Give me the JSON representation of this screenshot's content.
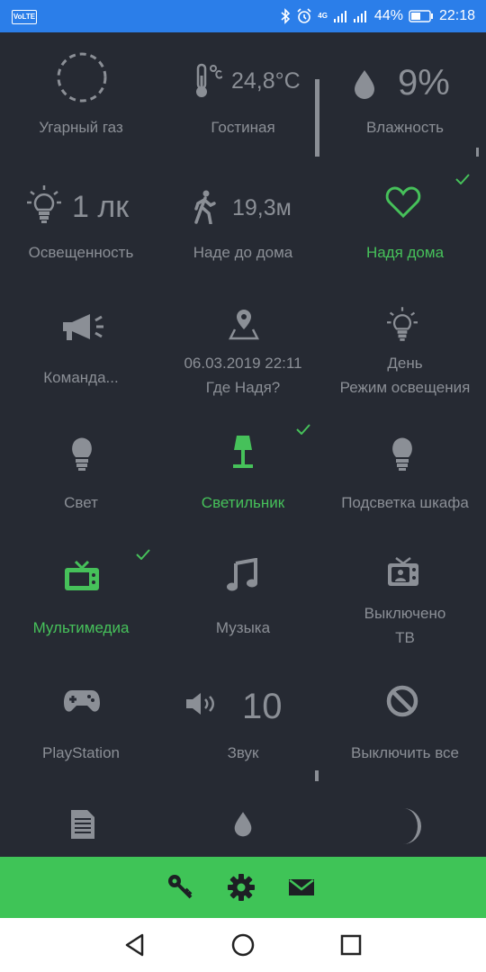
{
  "status_bar": {
    "volte": "VoLTE",
    "network": "4G",
    "battery": "44%",
    "time": "22:18",
    "icons": [
      "bluetooth-icon",
      "alarm-icon",
      "signal-icon",
      "signal-icon",
      "battery-icon"
    ]
  },
  "tiles": [
    {
      "label": "Угарный газ",
      "icon": "gas-sensor-ring-icon",
      "state": "off"
    },
    {
      "label": "Гостиная",
      "value": "24,8°C",
      "icon": "thermometer-icon",
      "state": "off"
    },
    {
      "label": "Влажность",
      "value": "9%",
      "icon": "drop-icon",
      "state": "off"
    },
    {
      "label": "Освещенность",
      "value": "1 лк",
      "icon": "lightbulb-rays-icon",
      "state": "off"
    },
    {
      "label": "Наде до дома",
      "value": "19,3м",
      "icon": "walking-person-icon",
      "state": "off"
    },
    {
      "label": "Надя дома",
      "icon": "heart-icon",
      "state": "on",
      "checked": true
    },
    {
      "label": "Команда...",
      "icon": "megaphone-icon",
      "state": "off"
    },
    {
      "label_line1": "06.03.2019 22:11",
      "label_line2": "Где Надя?",
      "icon": "map-pin-icon",
      "state": "off"
    },
    {
      "label_line1": "День",
      "label_line2": "Режим освещения",
      "icon": "lightbulb-rays-icon",
      "state": "off"
    },
    {
      "label": "Свет",
      "icon": "lightbulb-icon",
      "state": "off"
    },
    {
      "label": "Светильник",
      "icon": "lamp-icon",
      "state": "on",
      "checked": true
    },
    {
      "label": "Подсветка шкафа",
      "icon": "lightbulb-icon",
      "state": "off"
    },
    {
      "label": "Мультимедиа",
      "icon": "tv-icon",
      "state": "on",
      "checked": true
    },
    {
      "label": "Музыка",
      "icon": "music-note-icon",
      "state": "off"
    },
    {
      "label_line1": "Выключено",
      "label_line2": "ТВ",
      "icon": "tv-channel-icon",
      "state": "off"
    },
    {
      "label": "PlayStation",
      "icon": "gamepad-icon",
      "state": "off"
    },
    {
      "label": "Звук",
      "value": "10",
      "icon": "speaker-icon",
      "state": "off"
    },
    {
      "label": "Выключить все",
      "icon": "block-icon",
      "state": "off"
    },
    {
      "icon": "document-icon",
      "state": "off"
    },
    {
      "icon": "drop-icon",
      "state": "off"
    },
    {
      "icon": "moon-icon",
      "state": "off"
    }
  ],
  "bottom_bar": {
    "buttons": [
      "key-icon",
      "gear-icon",
      "mail-icon"
    ]
  },
  "nav_bar": {
    "buttons": [
      "back-icon",
      "home-icon",
      "recents-icon"
    ]
  },
  "colors": {
    "status_bar": "#2b7ee9",
    "background": "#262a33",
    "inactive": "#8b8f96",
    "active": "#46c15a",
    "bottom_bar": "#3fc457"
  }
}
